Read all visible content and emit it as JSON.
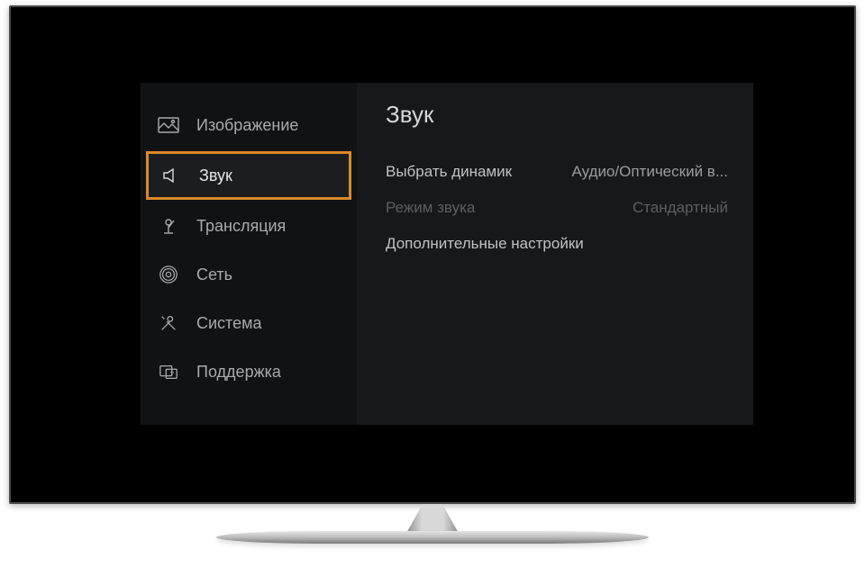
{
  "sidebar": {
    "items": [
      {
        "label": "Изображение",
        "icon": "image"
      },
      {
        "label": "Звук",
        "icon": "speaker"
      },
      {
        "label": "Трансляция",
        "icon": "antenna"
      },
      {
        "label": "Сеть",
        "icon": "network"
      },
      {
        "label": "Система",
        "icon": "tools"
      },
      {
        "label": "Поддержка",
        "icon": "support"
      }
    ],
    "selected_index": 1
  },
  "content": {
    "title": "Звук",
    "rows": [
      {
        "label": "Выбрать динамик",
        "value": "Аудио/Оптический в...",
        "disabled": false
      },
      {
        "label": "Режим звука",
        "value": "Стандартный",
        "disabled": true
      },
      {
        "label": "Дополнительные настройки",
        "value": "",
        "disabled": false
      }
    ]
  }
}
